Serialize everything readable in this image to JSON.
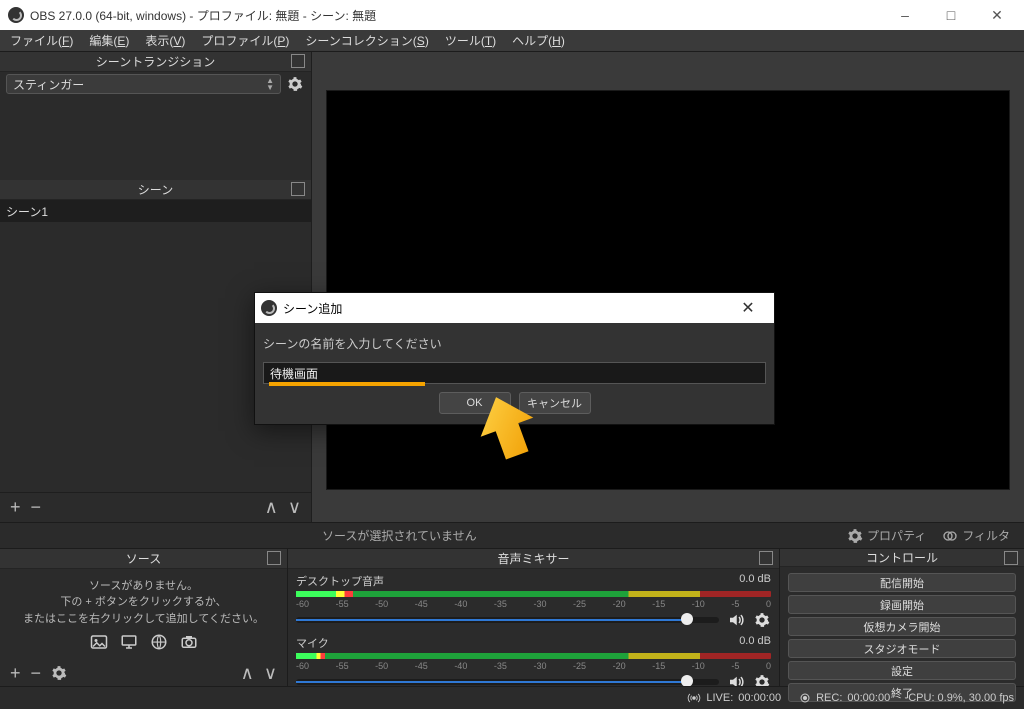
{
  "window": {
    "title": "OBS 27.0.0 (64-bit, windows) - プロファイル: 無題 - シーン: 無題"
  },
  "menubar": [
    {
      "label": "ファイル",
      "accel": "F"
    },
    {
      "label": "編集",
      "accel": "E"
    },
    {
      "label": "表示",
      "accel": "V"
    },
    {
      "label": "プロファイル",
      "accel": "P"
    },
    {
      "label": "シーンコレクション",
      "accel": "S"
    },
    {
      "label": "ツール",
      "accel": "T"
    },
    {
      "label": "ヘルプ",
      "accel": "H"
    }
  ],
  "panels": {
    "transitions_title": "シーントランジション",
    "transition_selected": "スティンガー",
    "scenes_title": "シーン",
    "scene_items": [
      "シーン1"
    ],
    "sources_title": "ソース",
    "sources_empty_l1": "ソースがありません。",
    "sources_empty_l2": "下の + ボタンをクリックするか、",
    "sources_empty_l3": "またはここを右クリックして追加してください。",
    "mixer_title": "音声ミキサー",
    "controls_title": "コントロール"
  },
  "sources_bar": {
    "no_selection": "ソースが選択されていません",
    "properties": "プロパティ",
    "filters": "フィルタ"
  },
  "mixer": {
    "channels": [
      {
        "name": "デスクトップ音声",
        "db": "0.0 dB"
      },
      {
        "name": "マイク",
        "db": "0.0 dB"
      }
    ],
    "ticks": [
      "-60",
      "-55",
      "-50",
      "-45",
      "-40",
      "-35",
      "-30",
      "-25",
      "-20",
      "-15",
      "-10",
      "-5",
      "0"
    ]
  },
  "controls": {
    "buttons": [
      "配信開始",
      "録画開始",
      "仮想カメラ開始",
      "スタジオモード",
      "設定",
      "終了"
    ]
  },
  "statusbar": {
    "live_label": "LIVE:",
    "live_time": "00:00:00",
    "rec_label": "REC:",
    "rec_time": "00:00:00",
    "cpu": "CPU: 0.9%, 30.00 fps"
  },
  "dialog": {
    "title": "シーン追加",
    "prompt": "シーンの名前を入力してください",
    "input_value": "待機画面",
    "ok": "OK",
    "cancel": "キャンセル"
  }
}
